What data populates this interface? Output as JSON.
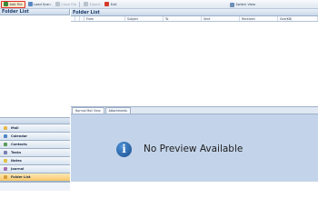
{
  "toolbar": {
    "add_file": "Add File",
    "load_scan": "Load Scan",
    "close_file": "Close File",
    "export": "Export",
    "exit": "Exit",
    "switch_view": "Switch View"
  },
  "left_pane": {
    "title": "Folder List",
    "nav_items": [
      "Mail",
      "Calendar",
      "Contacts",
      "Tasks",
      "Notes",
      "Journal",
      "Folder List"
    ]
  },
  "right_pane": {
    "title": "Folder List",
    "columns": [
      "From",
      "Subject",
      "To",
      "Sent",
      "Received",
      "Size(KB)"
    ],
    "tabs": [
      "Normal Mail View",
      "Attachments"
    ],
    "preview_text": "No Preview Available"
  },
  "colors": {
    "accent": "#1d4f8f",
    "preview_bg": "#c3d4ea",
    "selected_nav": "#f8c76a"
  }
}
